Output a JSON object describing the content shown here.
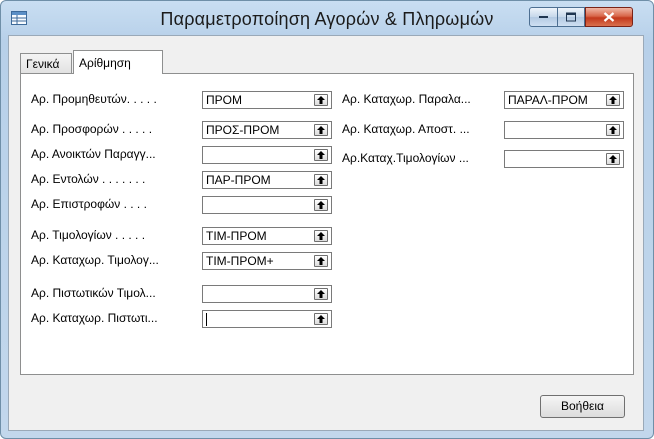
{
  "window": {
    "title": "Παραμετροποίηση Αγορών & Πληρωμών"
  },
  "tabs": [
    {
      "label": "Γενικά",
      "active": false
    },
    {
      "label": "Αρίθμηση",
      "active": true
    }
  ],
  "left_fields": [
    {
      "label": "Αρ. Προμηθευτών. . . . .",
      "value": "ΠΡΟΜ"
    },
    {
      "label": "Αρ. Προσφορών  . . . . .",
      "value": "ΠΡΟΣ-ΠΡΟΜ"
    },
    {
      "label": "Αρ. Ανοικτών Παραγγ...",
      "value": ""
    },
    {
      "label": "Αρ. Εντολών . . . . . . .",
      "value": "ΠΑΡ-ΠΡΟΜ"
    },
    {
      "label": "Αρ. Επιστροφών  . . . .",
      "value": ""
    },
    {
      "label": "Αρ. Τιμολογίων . . . . .",
      "value": "ΤΙΜ-ΠΡΟΜ"
    },
    {
      "label": "Αρ. Καταχωρ. Τιμολογ...",
      "value": "ΤΙΜ-ΠΡΟΜ+"
    },
    {
      "label": "Αρ. Πιστωτικών Τιμολ...",
      "value": ""
    },
    {
      "label": "Αρ. Καταχωρ. Πιστωτι...",
      "value": ""
    }
  ],
  "right_fields": [
    {
      "label": "Αρ. Καταχωρ. Παραλα...",
      "value": "ΠΑΡΑΛ-ΠΡΟΜ"
    },
    {
      "label": "Αρ. Καταχωρ. Αποστ. ...",
      "value": ""
    },
    {
      "label": "Αρ.Καταχ.Τιμολογίων ...",
      "value": ""
    }
  ],
  "buttons": {
    "help": "Βοήθεια"
  },
  "icons": {
    "app": "table-icon",
    "assist": "up-arrow-icon"
  }
}
